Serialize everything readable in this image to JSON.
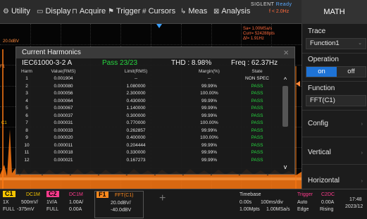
{
  "menu": {
    "items": [
      {
        "icon": "⚙",
        "label": "Utility",
        "name": "utility"
      },
      {
        "icon": "▭",
        "label": "Display",
        "name": "display"
      },
      {
        "icon": "⊓",
        "label": "Acquire",
        "name": "acquire"
      },
      {
        "icon": "⚑",
        "label": "Trigger",
        "name": "trigger"
      },
      {
        "icon": "#",
        "label": "Cursors",
        "name": "cursors"
      },
      {
        "icon": "↳",
        "label": "Meas",
        "name": "meas"
      },
      {
        "icon": "⊠",
        "label": "Analysis",
        "name": "analysis"
      }
    ],
    "brand": "SIGLENT",
    "status": "Ready",
    "trig_freq": "f < 2.0Hz",
    "panel_title": "MATH"
  },
  "wave": {
    "scale_label": "20.0dBV",
    "sample_info": [
      "Sa= 1.00MSa/s",
      "Curr= 524288pts",
      "Δf= 1.91Hz"
    ],
    "left_marker": "F1",
    "mid_marker": "C1"
  },
  "dialog": {
    "title": "Current Harmonics",
    "close": "×",
    "standard": "IEC61000-3-2 A",
    "pass": "Pass 23/23",
    "thd": "THD : 8.98%",
    "freq": "Freq : 62.37Hz",
    "headers": {
      "harm": "Harm",
      "value": "Value(RMS)",
      "limit": "Limit(RMS)",
      "margin": "Margin(%)",
      "state": "State"
    },
    "rows": [
      {
        "harm": "1",
        "value": "0.001904",
        "limit": "--",
        "margin": "--",
        "state": "NON SPEC"
      },
      {
        "harm": "2",
        "value": "0.000080",
        "limit": "1.080000",
        "margin": "99.99%",
        "state": "PASS"
      },
      {
        "harm": "3",
        "value": "0.000056",
        "limit": "2.300000",
        "margin": "100.00%",
        "state": "PASS"
      },
      {
        "harm": "4",
        "value": "0.000064",
        "limit": "0.430000",
        "margin": "99.99%",
        "state": "PASS"
      },
      {
        "harm": "5",
        "value": "0.000067",
        "limit": "1.140000",
        "margin": "99.99%",
        "state": "PASS"
      },
      {
        "harm": "6",
        "value": "0.000037",
        "limit": "0.300000",
        "margin": "99.99%",
        "state": "PASS"
      },
      {
        "harm": "7",
        "value": "0.000031",
        "limit": "0.770000",
        "margin": "100.00%",
        "state": "PASS"
      },
      {
        "harm": "8",
        "value": "0.000033",
        "limit": "0.262857",
        "margin": "99.99%",
        "state": "PASS"
      },
      {
        "harm": "9",
        "value": "0.000020",
        "limit": "0.400000",
        "margin": "100.00%",
        "state": "PASS"
      },
      {
        "harm": "10",
        "value": "0.000011",
        "limit": "0.204444",
        "margin": "99.99%",
        "state": "PASS"
      },
      {
        "harm": "11",
        "value": "0.000018",
        "limit": "0.330000",
        "margin": "99.99%",
        "state": "PASS"
      },
      {
        "harm": "12",
        "value": "0.000021",
        "limit": "0.167273",
        "margin": "99.99%",
        "state": "PASS"
      }
    ],
    "scroll_up": "^",
    "scroll_down": "v"
  },
  "panel": {
    "trace_label": "Trace",
    "trace_value": "Function1",
    "operation_label": "Operation",
    "on": "on",
    "off": "off",
    "function_label": "Function",
    "function_value": "FFT(C1)",
    "config": "Config",
    "vertical": "Vertical",
    "horizontal": "Horizontal"
  },
  "status": {
    "c1": {
      "badge": "C1",
      "l1": "1X",
      "l2": "FULL",
      "v1": "500mV/",
      "v2": "-375mV",
      "u1": "1V/A",
      "u2": "FULL",
      "tag": "DC1M"
    },
    "c2": {
      "badge": "C2",
      "tag": "DC1M",
      "v1": "1.00A/",
      "v2": "0.00A"
    },
    "f1": {
      "badge": "F1",
      "tag": "FFT(C1)",
      "v1": "20.0dBV/",
      "v2": "-40.0dBV"
    },
    "timebase": {
      "title": "Timebase",
      "l1a": "0.00s",
      "l1b": "100ms/div",
      "l2a": "1.00Mpts",
      "l2b": "1.00MSa/s"
    },
    "trigger": {
      "title": "Trigger",
      "src": "C2DC",
      "l1a": "Auto",
      "l1b": "0.00A",
      "l2a": "Edge",
      "l2b": "Rising"
    },
    "clock": {
      "time": "17:48",
      "date": "2023/12"
    }
  },
  "colors": {
    "c1": "#f5c400",
    "c2": "#ff3b8d",
    "f1": "#ff8a1e",
    "pass": "#26d63f",
    "accent": "#1e73d6"
  }
}
